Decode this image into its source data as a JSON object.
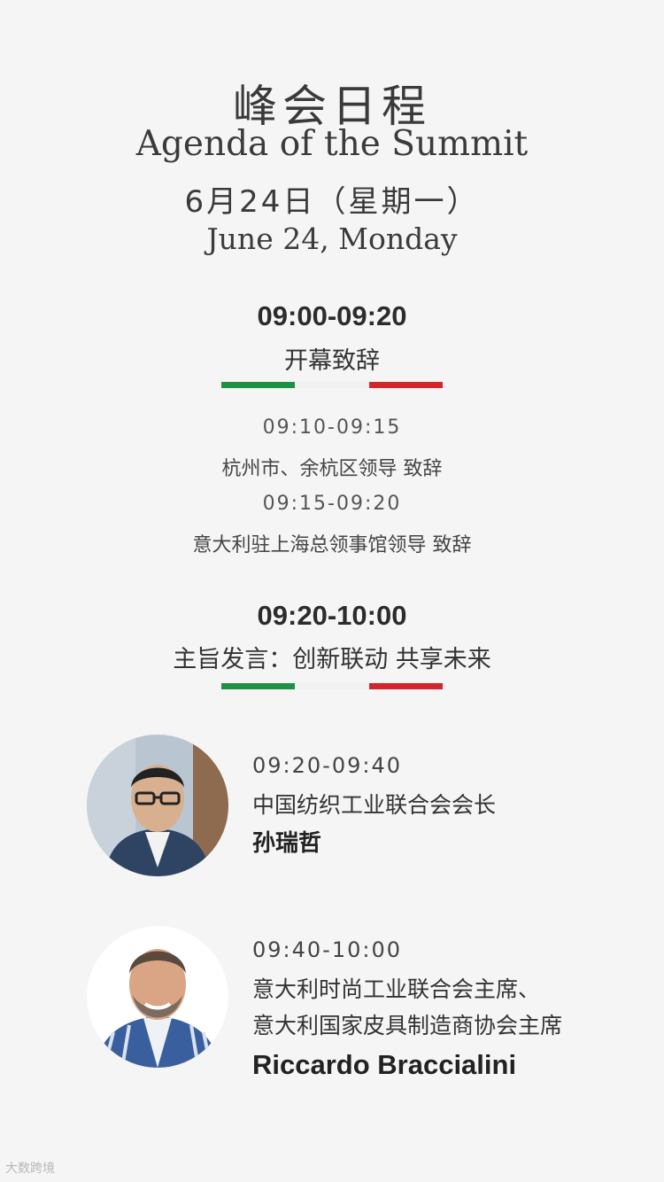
{
  "header": {
    "title_cn": "峰会日程",
    "title_en": "Agenda of the Summit",
    "date_cn": "6月24日（星期一）",
    "date_en": "June 24, Monday"
  },
  "colors": {
    "green": "#1f9145",
    "white": "#f1f1f1",
    "red": "#d1262c"
  },
  "sections": [
    {
      "time": "09:00-09:20",
      "title": "开幕致辞",
      "items": [
        {
          "time": "09:10-09:15",
          "text": "杭州市、余杭区领导  致辞"
        },
        {
          "time": "09:15-09:20",
          "text": "意大利驻上海总领事馆领导  致辞"
        }
      ]
    },
    {
      "time": "09:20-10:00",
      "title": "主旨发言：创新联动 共享未来",
      "speakers": [
        {
          "time": "09:20-09:40",
          "role": [
            "中国纺织工业联合会会长"
          ],
          "name": "孙瑞哲",
          "icon": "speaker-photo-icon"
        },
        {
          "time": "09:40-10:00",
          "role": [
            "意大利时尚工业联合会主席、",
            "意大利国家皮具制造商协会主席"
          ],
          "name": "Riccardo Braccialini",
          "icon": "speaker-photo-icon"
        }
      ]
    }
  ],
  "watermark": "大数跨境"
}
